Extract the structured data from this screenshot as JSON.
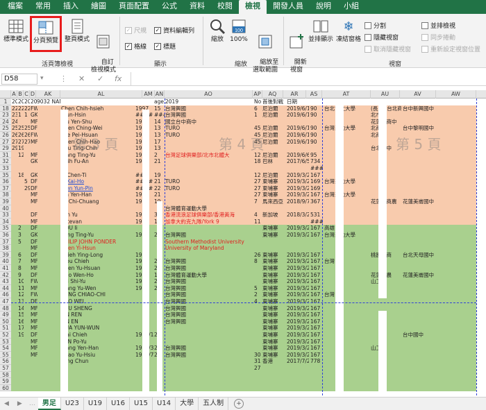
{
  "menu_tabs": [
    "檔案",
    "常用",
    "插入",
    "繪圖",
    "頁面配置",
    "公式",
    "資料",
    "校閱",
    "檢視",
    "開發人員",
    "說明",
    "小組"
  ],
  "ribbon": {
    "normal": "標準模式",
    "pagebreak": "分頁預覽",
    "pagelayout": "整頁模式",
    "custom": "自訂\n檢視模式",
    "group_views": "活頁簿檢視",
    "ruler": "尺規",
    "formula_bar": "資料編輯列",
    "gridlines": "格線",
    "headings": "標題",
    "group_show": "顯示",
    "zoom": "縮放",
    "zoom100": "100%",
    "zoom_sel": "縮放至\n選取範圍",
    "group_zoom": "縮放",
    "new_window": "開新\n視窗",
    "arrange_all": "並排顯示",
    "freeze": "凍結窗格",
    "split": "分割",
    "hide": "隱藏視窗",
    "unhide": "取消隱藏視窗",
    "side_by_side": "並排檢視",
    "sync_scroll": "同步捲動",
    "reset_pos": "重新設定視窗位置",
    "group_window": "視窗"
  },
  "name_box": "D58",
  "columns": [
    "A",
    "B",
    "C",
    "D",
    "AK",
    "AL",
    "AM",
    "AN",
    "AO",
    "AP",
    "AQ",
    "AR",
    "AS",
    "AT",
    "AU",
    "AV",
    "AW"
  ],
  "watermarks": [
    "第 3 頁",
    "第 4 頁",
    "第 5 頁"
  ],
  "rows": [
    {
      "n": "1",
      "a": "201",
      "b": "201",
      "c": "201",
      "d": "201",
      "ak": "9032 NAME",
      "al": "",
      "am": "",
      "an": "age",
      "ao": "2019",
      "ap": "No",
      "aq": "首後對戰",
      "ar": "日期",
      "as": "",
      "at": "",
      "au": "",
      "av": "",
      "c1": "w"
    },
    {
      "n": "18",
      "a": "22",
      "b": "22",
      "c": "22",
      "d": "FW",
      "ak": "",
      "al": "Chen Chih-hsieh",
      "am": "1997",
      "an": "15",
      "ao": "台灣興國",
      "ap": "6",
      "aq": "尼泊爾",
      "ar": "2019/6/11",
      "as": "90",
      "at": "台北市立大學",
      "au": "(長風) 台北商中",
      "av": "台中新興國中",
      "c1": "o"
    },
    {
      "n": "23",
      "a": "23",
      "b": "1",
      "c": "1",
      "d": "GK",
      "ak": "",
      "al": "Tsun-Hsin",
      "am": "####",
      "an": "###",
      "ao": "台灣興國",
      "ap": "1",
      "aq": "尼泊爾",
      "ar": "2019/6/11",
      "as": "90",
      "at": "",
      "au": "北市",
      "av": "",
      "c1": "o"
    },
    {
      "n": "24",
      "a": "24",
      "b": "",
      "c": "",
      "d": "MF",
      "ak": "",
      "al": "Wu Yen-Shu",
      "am": "1997",
      "an": "14",
      "ao": "國立台中商中",
      "ap": "",
      "aq": "",
      "ar": "",
      "as": "",
      "at": "",
      "au": "花蓮縣商中",
      "av": "",
      "c1": "o"
    },
    {
      "n": "25",
      "a": "25",
      "b": "25",
      "c": "25",
      "d": "DF",
      "ak": "",
      "al": "Chen Ching-Wei",
      "am": "199",
      "an": "13",
      "ao": "TURO",
      "ap": "45",
      "aq": "尼泊爾",
      "ar": "2019/6/11",
      "as": "90",
      "at": "台灣運動大學",
      "au": "北商中",
      "av": "台中黎明國中",
      "c1": "o"
    },
    {
      "n": "26",
      "a": "26",
      "b": "26",
      "c": "26",
      "d": "FW",
      "ak": "",
      "al": "Lee Pei-Hsuan",
      "am": "199",
      "an": "13",
      "ao": "TURO",
      "ap": "45",
      "aq": "尼泊爾",
      "ar": "2019/6/11",
      "as": "90",
      "at": "",
      "au": "北商中",
      "av": "",
      "c1": "o"
    },
    {
      "n": "27",
      "a": "27",
      "b": "27",
      "c": "27",
      "d": "MF",
      "ak": "",
      "al": "Chen Chih-Hao",
      "am": "199",
      "an": "17",
      "ao": "",
      "ap": "45",
      "aq": "尼泊爾",
      "ar": "2019/6/11",
      "as": "90",
      "at": "",
      "au": "",
      "av": "",
      "c1": "o"
    },
    {
      "n": "29",
      "a": "29",
      "b": "19",
      "c": "",
      "d": "",
      "ak": "",
      "al": "Hsu Ting-Chih",
      "am": "199",
      "an": "13",
      "ao": "",
      "ap": "",
      "aq": "",
      "ar": "",
      "as": "",
      "at": "",
      "au": "台北商中",
      "av": "",
      "c1": "o"
    },
    {
      "n": "31",
      "a": "",
      "b": "12",
      "c": "",
      "d": "MF",
      "ak": "",
      "al": "Wang Ting-Yu",
      "am": "199",
      "an": "2",
      "ao": "台灣足球俱樂部/北市北體大",
      "ap": "12",
      "aq": "尼泊爾",
      "ar": "2019/6/6",
      "as": "95",
      "at": "",
      "au": "",
      "av": "",
      "c1": "o",
      "red": true
    },
    {
      "n": "32",
      "a": "",
      "b": "",
      "c": "",
      "d": "GK",
      "ak": "",
      "al": "Shih Fu-An",
      "am": "199",
      "an": "21",
      "ao": "",
      "ap": "18",
      "aq": "巴林",
      "ar": "2017/6/5",
      "as": "734",
      "at": "",
      "au": "",
      "av": "",
      "c1": "o"
    },
    {
      "n": "33",
      "a": "",
      "b": "",
      "c": "",
      "d": "",
      "ak": "",
      "al": "",
      "am": "",
      "an": "",
      "ao": "",
      "ap": "",
      "aq": "",
      "ar": "",
      "as": "####",
      "at": "",
      "au": "",
      "av": "",
      "c1": "o"
    },
    {
      "n": "35",
      "a": "",
      "b": "18",
      "c": "",
      "d": "GK",
      "ak": "",
      "al": "Li Chen-Ti",
      "am": "###",
      "an": "19",
      "ao": "",
      "ap": "12",
      "aq": "尼泊爾",
      "ar": "2019/3/26",
      "as": "167",
      "at": "",
      "au": "",
      "av": "",
      "c1": "o"
    },
    {
      "n": "36",
      "a": "",
      "b": "",
      "c": "5",
      "d": "DF",
      "ak": "",
      "al": "Li Kai-Ho",
      "am": "####",
      "an": "21",
      "ao": "TURO",
      "ap": "27",
      "aq": "柬埔寨",
      "ar": "2019/3/24",
      "as": "169",
      "at": "台灣運動大學",
      "au": "",
      "av": "",
      "c1": "o",
      "blue": true
    },
    {
      "n": "37",
      "a": "",
      "b": "",
      "c": "29",
      "d": "DF",
      "ak": "",
      "al": "Wen Yun-Pin",
      "am": "####",
      "an": "22",
      "ao": "TURO",
      "ap": "27",
      "aq": "柬埔寨",
      "ar": "2019/3/24",
      "as": "169",
      "at": "",
      "au": "",
      "av": "",
      "c1": "o",
      "blue": true
    },
    {
      "n": "38",
      "a": "",
      "b": "",
      "c": "",
      "d": "MF",
      "ak": "",
      "al": "Lin Yen-Han",
      "am": "199",
      "an": "21",
      "ao": "",
      "ap": "27",
      "aq": "柬埔寨",
      "ar": "2019/3/26",
      "as": "167",
      "at": "台灣運動大學",
      "au": "",
      "av": "",
      "c1": "o"
    },
    {
      "n": "39",
      "a": "",
      "b": "",
      "c": "",
      "d": "MF",
      "ak": "",
      "al": "Yu Chi-Chuang",
      "am": "199",
      "an": "19",
      "ao": "",
      "ap": "7",
      "aq": "馬來西亞",
      "ar": "2018/9/7",
      "as": "367",
      "at": "",
      "au": "花蓮縣商農",
      "av": "花蓮美崙國中",
      "c1": "o"
    },
    {
      "n": "40",
      "a": "",
      "b": "",
      "c": "",
      "d": "",
      "ak": "",
      "al": "",
      "am": "",
      "an": "",
      "ao": "台灣體育運動大學",
      "ap": "",
      "aq": "",
      "ar": "",
      "as": "",
      "at": "",
      "au": "",
      "av": "",
      "c1": "o"
    },
    {
      "n": "33",
      "a": "",
      "b": "",
      "c": "",
      "d": "DF",
      "ak": "",
      "al": "Yen Yu",
      "am": "198",
      "an": "31",
      "ao": "香港流浪足球俱樂部/香港黃海",
      "ap": "4",
      "aq": "新加坡",
      "ar": "2018/3/27",
      "as": "531",
      "at": "",
      "au": "",
      "av": "",
      "c1": "o",
      "red": true
    },
    {
      "n": "34",
      "a": "",
      "b": "",
      "c": "",
      "d": "MF",
      "ak": "",
      "al": "Estevan",
      "am": "199",
      "an": "15",
      "ao": "加拿大約克九隊/York 9",
      "ap": "11",
      "aq": "",
      "ar": "",
      "as": "####",
      "at": "",
      "au": "",
      "av": "",
      "c1": "o",
      "red": true
    },
    {
      "n": "35",
      "a": "",
      "b": "2",
      "c": "",
      "d": "DF",
      "ak": "",
      "al": "HOU Ii",
      "am": "",
      "an": "",
      "ao": "",
      "ap": "",
      "aq": "東埔寨",
      "ar": "2019/3/26",
      "as": "167",
      "at": "高雄",
      "au": "",
      "av": "",
      "c1": "g"
    },
    {
      "n": "36",
      "a": "",
      "b": "3",
      "c": "",
      "d": "GK",
      "ak": "",
      "al": "Jiang Ting-Yu",
      "am": "199",
      "an": "22",
      "ao": "台灣興國",
      "ap": "",
      "aq": "東埔寨",
      "ar": "2019/3/26",
      "as": "167",
      "at": "台灣運動大學",
      "au": "",
      "av": "",
      "c1": "g"
    },
    {
      "n": "37",
      "a": "",
      "b": "5",
      "c": "",
      "d": "DF",
      "ak": "",
      "al": "PHILIP JOHN PONDER",
      "am": "",
      "an": "",
      "ao": "Southern Methodist University",
      "ap": "",
      "aq": "",
      "ar": "",
      "as": "",
      "at": "",
      "au": "",
      "av": "",
      "c1": "g",
      "red2": true
    },
    {
      "n": "38",
      "a": "",
      "b": "",
      "c": "",
      "d": "MF",
      "ak": "",
      "al": "Chen Yi-Hsun",
      "am": "",
      "an": "",
      "ao": "University of Maryland",
      "ap": "",
      "aq": "",
      "ar": "",
      "as": "",
      "at": "",
      "au": "",
      "av": "",
      "c1": "g",
      "red2": true
    },
    {
      "n": "39",
      "a": "",
      "b": "6",
      "c": "",
      "d": "DF",
      "ak": "",
      "al": "Hsieh Ying-Long",
      "am": "199",
      "an": "",
      "ao": "",
      "ap": "26",
      "aq": "東埔寨",
      "ar": "2019/3/26",
      "as": "167",
      "at": "",
      "au": "桃園高商",
      "av": "台北天母國中",
      "c1": "g"
    },
    {
      "n": "40",
      "a": "",
      "b": "7",
      "c": "",
      "d": "MF",
      "ak": "",
      "al": "Tsou Chieh",
      "am": "199",
      "an": "24",
      "ao": "台灣興國",
      "ap": "8",
      "aq": "東埔寨",
      "ar": "2019/3/26",
      "as": "167",
      "at": "台灣",
      "au": "",
      "av": "",
      "c1": "g"
    },
    {
      "n": "41",
      "a": "",
      "b": "8",
      "c": "",
      "d": "MF",
      "ak": "",
      "al": "Chen Yu-Hsuan",
      "am": "199",
      "an": "20",
      "ao": "台灣興國",
      "ap": "",
      "aq": "東埔寨",
      "ar": "2019/3/26",
      "as": "167",
      "at": "",
      "au": "",
      "av": "",
      "c1": "g"
    },
    {
      "n": "42",
      "a": "",
      "b": "9",
      "c": "",
      "d": "DF",
      "ak": "",
      "al": "Guo Wen-Ho",
      "am": "199",
      "an": "19",
      "ao": "台灣體育運動大學",
      "ap": "",
      "aq": "東埔寨",
      "ar": "2019/3/26",
      "as": "167",
      "at": "",
      "au": "花蓮商農",
      "av": "花蓮美崙國中",
      "c1": "g"
    },
    {
      "n": "43",
      "a": "",
      "b": "10",
      "c": "",
      "d": "FW",
      "ak": "",
      "al": "Pai Shi-Yu",
      "am": "199",
      "an": "20",
      "ao": "台灣興國",
      "ap": "",
      "aq": "東埔寨",
      "ar": "2019/3/26",
      "as": "167",
      "at": "",
      "au": "山工商",
      "av": "",
      "c1": "g"
    },
    {
      "n": "44",
      "a": "",
      "b": "11",
      "c": "",
      "d": "MF",
      "ak": "",
      "al": "Wang Yu-Wen",
      "am": "199",
      "an": "22",
      "ao": "台灣興國",
      "ap": "5",
      "aq": "東埔寨",
      "ar": "2019/3/26",
      "as": "167",
      "at": "",
      "au": "",
      "av": "",
      "c1": "g"
    },
    {
      "n": "46",
      "a": "",
      "b": "12",
      "c": "",
      "d": "FW",
      "ak": "",
      "al": "FONG CHIAO-CHI",
      "am": "",
      "an": "",
      "ao": "台灣興國",
      "ap": "2",
      "aq": "東埔寨",
      "ar": "2019/3/26",
      "as": "167",
      "at": "台灣",
      "au": "",
      "av": "",
      "c1": "g"
    },
    {
      "n": "47",
      "a": "",
      "b": "13",
      "c": "",
      "d": "DF",
      "ak": "",
      "al": "KUO WEI",
      "am": "",
      "an": "",
      "ao": "台灣興國",
      "ap": "4",
      "aq": "東埔寨",
      "ar": "2019/3/26",
      "as": "167",
      "at": "",
      "au": "",
      "av": "",
      "c1": "g"
    },
    {
      "n": "48",
      "a": "",
      "b": "14",
      "c": "",
      "d": "MF",
      "ak": "",
      "al": "HSU SHENG",
      "am": "",
      "an": "",
      "ao": "台灣興國",
      "ap": "",
      "aq": "東埔寨",
      "ar": "2019/3/26",
      "as": "167",
      "at": "",
      "au": "",
      "av": "",
      "c1": "g"
    },
    {
      "n": "49",
      "a": "",
      "b": "15",
      "c": "",
      "d": "MF",
      "ak": "",
      "al": "LIN REN",
      "am": "",
      "an": "",
      "ao": "台灣興國",
      "ap": "",
      "aq": "東埔寨",
      "ar": "2019/3/26",
      "as": "167",
      "at": "",
      "au": "",
      "av": "",
      "c1": "g"
    },
    {
      "n": "50",
      "a": "",
      "b": "16",
      "c": "",
      "d": "MF",
      "ak": "",
      "al": "LIN EN",
      "am": "",
      "an": "",
      "ao": "台灣興國",
      "ap": "",
      "aq": "東埔寨",
      "ar": "2019/3/26",
      "as": "167",
      "at": "",
      "au": "",
      "av": "",
      "c1": "g"
    },
    {
      "n": "51",
      "a": "",
      "b": "17",
      "c": "",
      "d": "MF",
      "ak": "",
      "al": "HUA YUN-WUN",
      "am": "",
      "an": "",
      "ao": "",
      "ap": "",
      "aq": "東埔寨",
      "ar": "2019/3/26",
      "as": "167",
      "at": "",
      "au": "",
      "av": "",
      "c1": "g"
    },
    {
      "n": "52",
      "a": "",
      "b": "19",
      "c": "",
      "d": "DF",
      "ak": "",
      "al": "Tsai Chieh",
      "am": "1999/1/2",
      "an": "20",
      "ao": "",
      "ap": "",
      "aq": "東埔寨",
      "ar": "2019/3/26",
      "as": "167",
      "at": "",
      "au": "",
      "av": "台中國中",
      "c1": "g"
    },
    {
      "n": "53",
      "a": "",
      "b": "",
      "c": "",
      "d": "MF",
      "ak": "",
      "al": "LAN Po-Yu",
      "am": "",
      "an": "",
      "ao": "",
      "ap": "",
      "aq": "東埔寨",
      "ar": "2019/3/26",
      "as": "167",
      "at": "",
      "au": "",
      "av": "",
      "c1": "g"
    },
    {
      "n": "54",
      "a": "",
      "b": "",
      "c": "",
      "d": "MF",
      "ak": "",
      "al": "Wang Yen-Han",
      "am": "1999/3/9",
      "an": "20",
      "ao": "台灣興國",
      "ap": "",
      "aq": "東埔寨",
      "ar": "2019/3/26",
      "as": "167",
      "at": "",
      "au": "山工商",
      "av": "",
      "c1": "g"
    },
    {
      "n": "55",
      "a": "",
      "b": "",
      "c": "",
      "d": "MF",
      "ak": "",
      "al": "Chao Yu-Hsiu",
      "am": "1997/7/9",
      "an": "22",
      "ao": "台灣興國",
      "ap": "30",
      "aq": "東埔寨",
      "ar": "2019/3/26",
      "as": "167",
      "at": "",
      "au": "",
      "av": "",
      "c1": "g"
    },
    {
      "n": "56",
      "a": "",
      "b": "",
      "c": "",
      "d": "",
      "ak": "",
      "al": "Yang Chun",
      "am": "",
      "an": "",
      "ao": "",
      "ap": "31",
      "aq": "香港",
      "ar": "2017/7/23",
      "as": "778",
      "at": "",
      "au": "",
      "av": "",
      "c1": "g"
    },
    {
      "n": "57",
      "a": "",
      "b": "",
      "c": "",
      "d": "",
      "ak": "",
      "al": "",
      "am": "",
      "an": "",
      "ao": "",
      "ap": "27",
      "aq": "",
      "ar": "",
      "as": "",
      "at": "",
      "au": "",
      "av": "",
      "c1": "g"
    },
    {
      "n": "58",
      "a": "",
      "b": "",
      "c": "",
      "d": "",
      "ak": "",
      "al": "",
      "am": "",
      "an": "",
      "ao": "",
      "ap": "",
      "aq": "",
      "ar": "",
      "as": "",
      "at": "",
      "au": "",
      "av": "",
      "c1": "g"
    },
    {
      "n": "59",
      "a": "",
      "b": "",
      "c": "",
      "d": "",
      "ak": "",
      "al": "",
      "am": "",
      "an": "",
      "ao": "",
      "ap": "",
      "aq": "",
      "ar": "",
      "as": "",
      "at": "",
      "au": "",
      "av": "",
      "c1": "g"
    },
    {
      "n": "60",
      "a": "",
      "b": "",
      "c": "",
      "d": "",
      "ak": "",
      "al": "",
      "am": "",
      "an": "",
      "ao": "",
      "ap": "",
      "aq": "",
      "ar": "",
      "as": "",
      "at": "",
      "au": "",
      "av": "",
      "c1": "g"
    }
  ],
  "sheet_tabs": [
    "男足",
    "U23",
    "U19",
    "U16",
    "U15",
    "U14",
    "大學",
    "五人制"
  ],
  "colors": {
    "excel_green": "#217346",
    "orange_fill": "#f8cbad",
    "green_fill": "#a9d08e",
    "highlight_red": "#e81c1c",
    "page_break": "#2e3fd8"
  }
}
